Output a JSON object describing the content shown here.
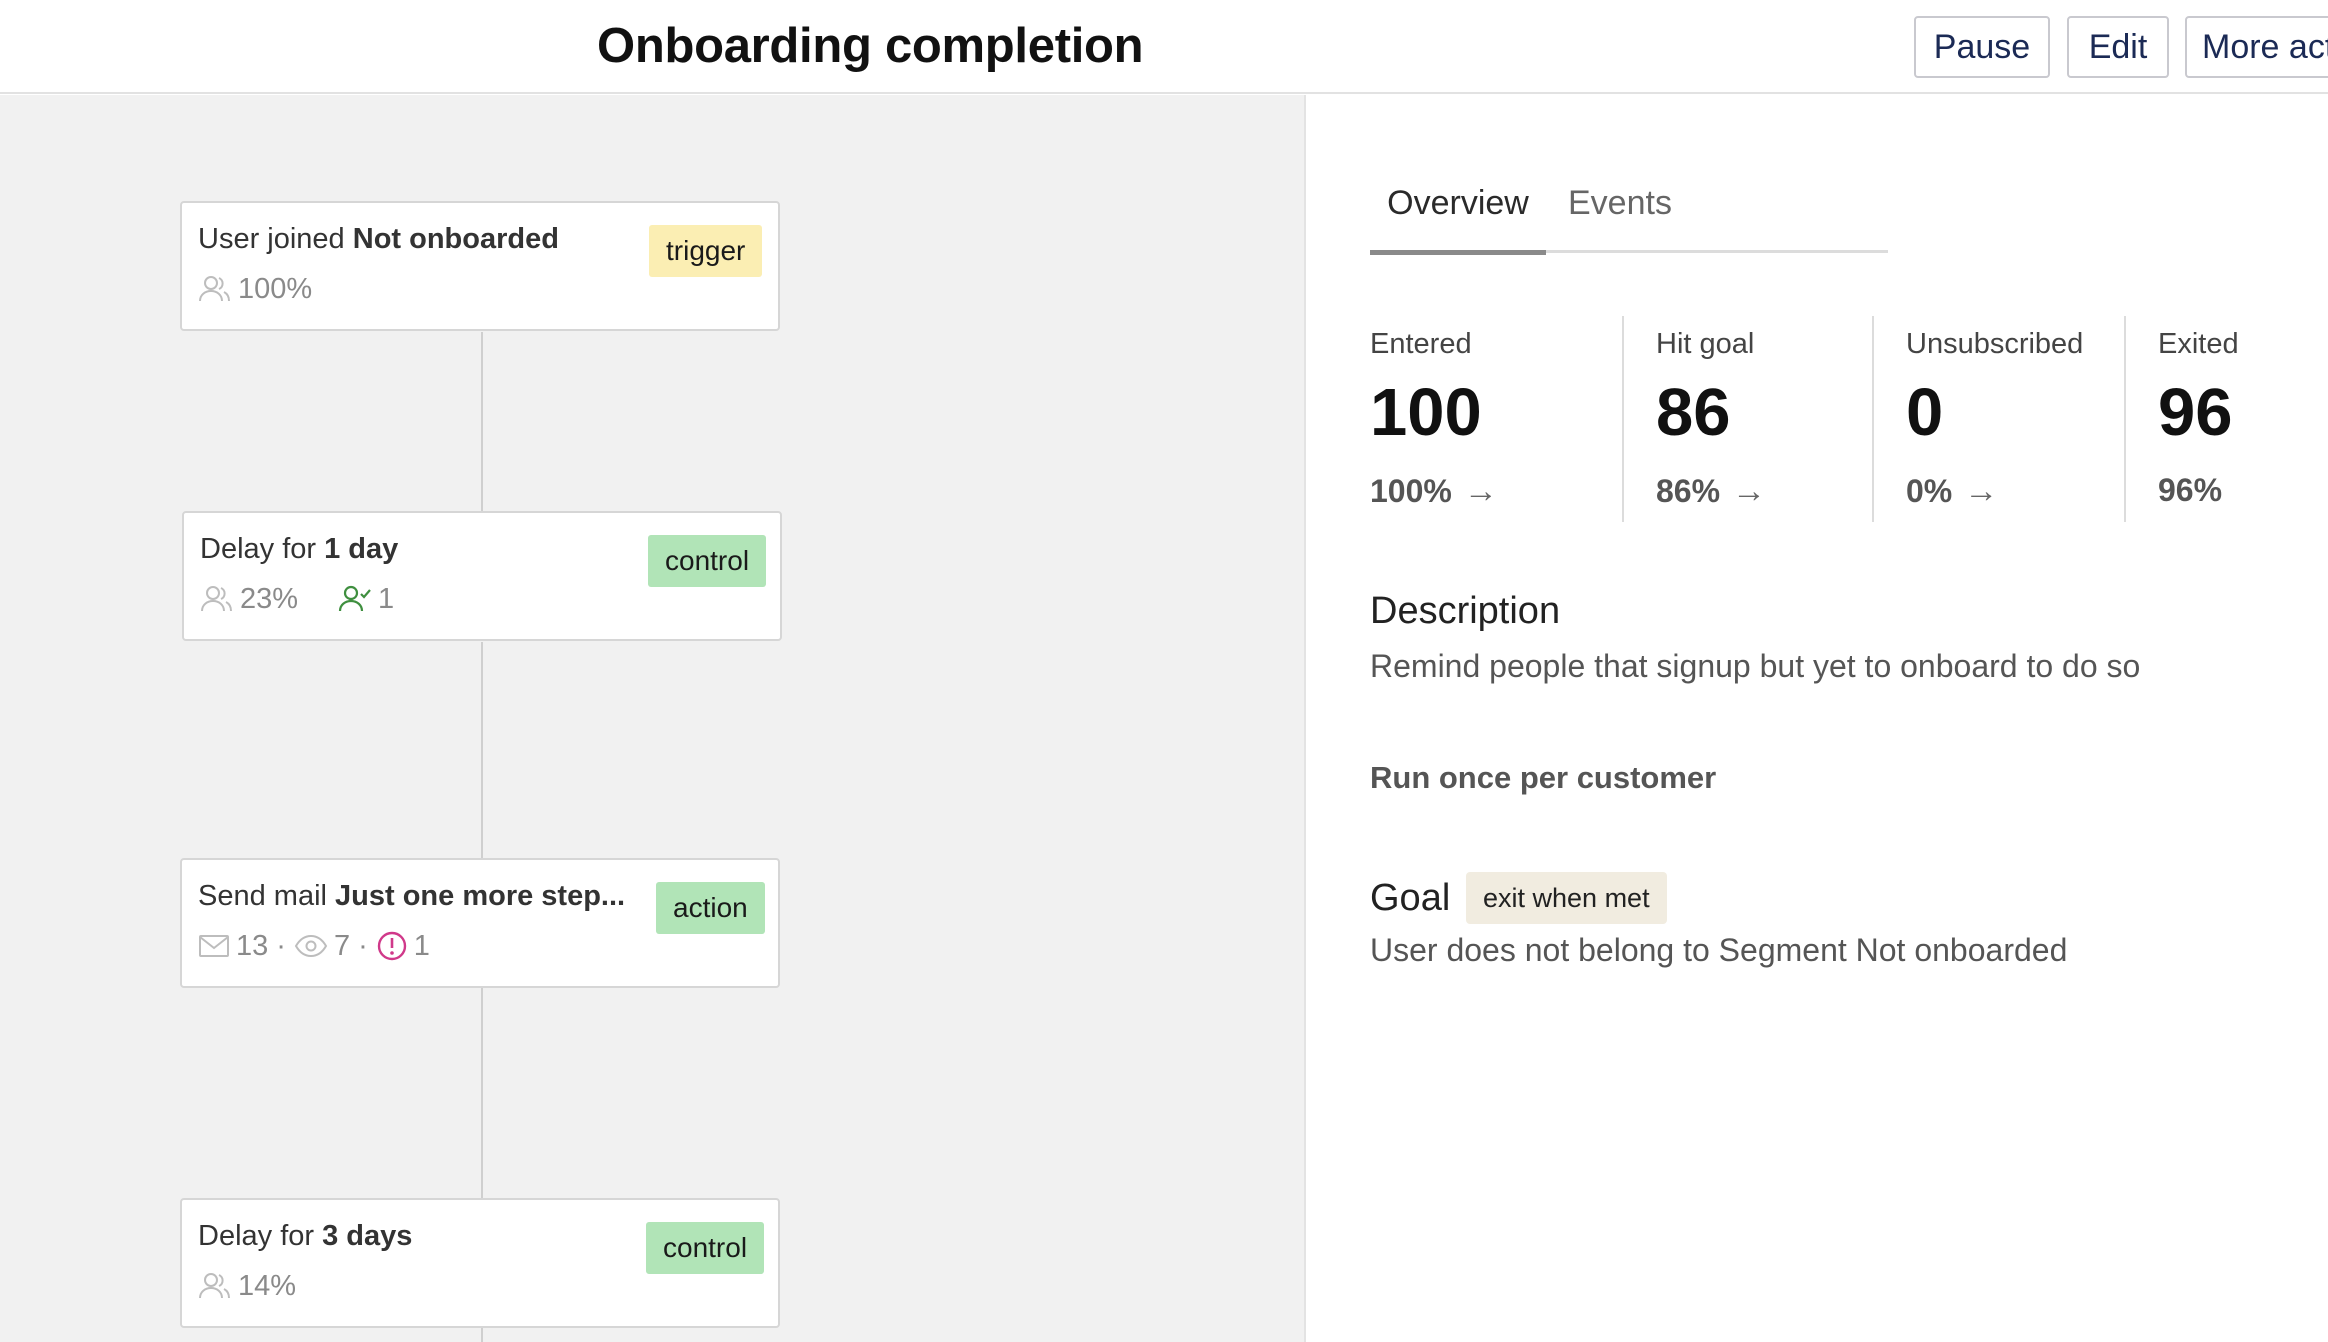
{
  "header": {
    "title": "Onboarding completion",
    "pause_label": "Pause",
    "edit_label": "Edit",
    "more_label": "More actions"
  },
  "workflow": {
    "nodes": [
      {
        "title_prefix": "User joined",
        "title_bold": "Not onboarded",
        "badge": "trigger",
        "people_pct": "100%"
      },
      {
        "title_prefix": "Delay for",
        "title_bold": "1 day",
        "badge": "control",
        "people_pct": "23%",
        "converted_count": "1"
      },
      {
        "title_prefix": "Send mail",
        "title_bold": "Just one more step...",
        "badge": "action",
        "sent_count": "13",
        "opened_count": "7",
        "failed_count": "1",
        "separator": "·"
      },
      {
        "title_prefix": "Delay for",
        "title_bold": "3 days",
        "badge": "control",
        "people_pct": "14%"
      }
    ]
  },
  "panel": {
    "tabs": [
      {
        "label": "Overview",
        "active": true
      },
      {
        "label": "Events",
        "active": false
      }
    ],
    "metrics": [
      {
        "label": "Entered",
        "value": "100",
        "pct": "100%",
        "arrow": "→"
      },
      {
        "label": "Hit goal",
        "value": "86",
        "pct": "86%",
        "arrow": "→"
      },
      {
        "label": "Unsubscribed",
        "value": "0",
        "pct": "0%",
        "arrow": "→"
      },
      {
        "label": "Exited",
        "value": "96",
        "pct": "96%"
      }
    ],
    "description_label": "Description",
    "description_text": "Remind people that signup but yet to onboard to do so",
    "run_mode": "Run once per customer",
    "goal_label": "Goal",
    "goal_badge": "exit when met",
    "goal_text": "User does not belong to Segment Not onboarded"
  },
  "colors": {
    "trigger_badge": "#fbeeb3",
    "control_badge": "#b1e4b7",
    "action_badge": "#b1e4b7",
    "canvas_bg": "#f1f1f1",
    "goal_badge": "#f1ece0",
    "converted_icon": "#3f8f3f",
    "failed_icon": "#d0398a",
    "button_text": "#1b2a55"
  }
}
